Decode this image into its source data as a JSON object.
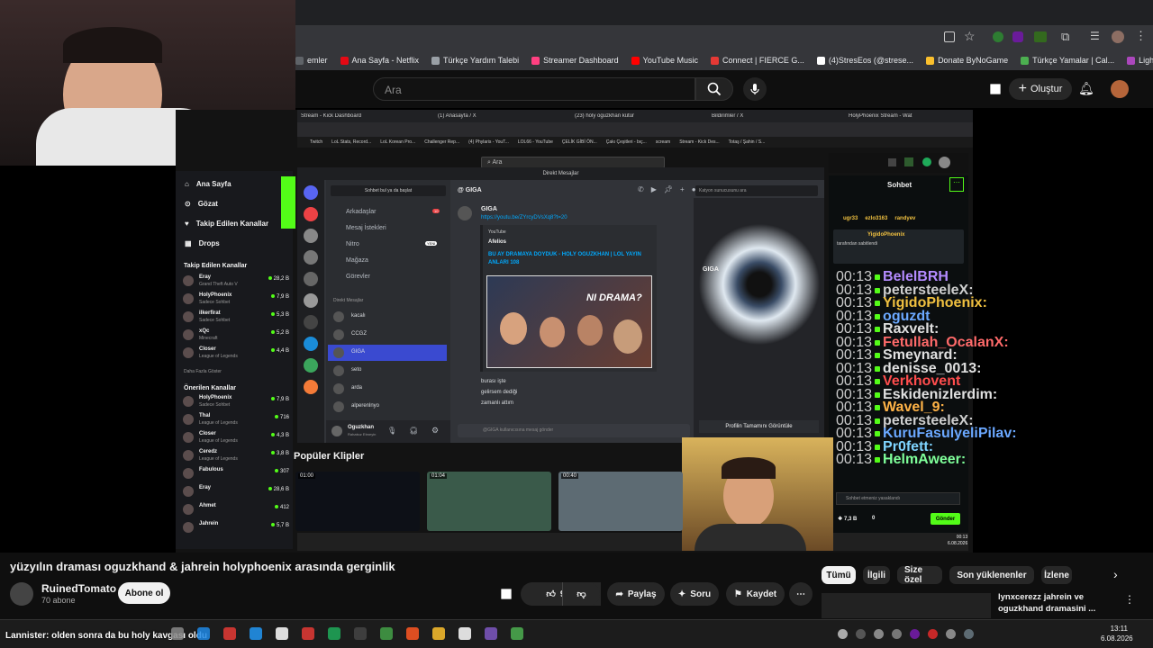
{
  "browser": {
    "bookmarks": [
      {
        "label": "emler",
        "color": "#5f6368"
      },
      {
        "label": "Ana Sayfa - Netflix",
        "color": "#e50914"
      },
      {
        "label": "Türkçe Yardım Talebi",
        "color": "#9aa0a6"
      },
      {
        "label": "Streamer Dashboard",
        "color": "#ff4081"
      },
      {
        "label": "YouTube Music",
        "color": "#ff0000"
      },
      {
        "label": "Connect | FIERCE G...",
        "color": "#e53935"
      },
      {
        "label": "(4)StresEos (@strese...",
        "color": "#ffffff"
      },
      {
        "label": "Donate ByNoGame",
        "color": "#fbc02d"
      },
      {
        "label": "Türkçe Yamalar | Cal...",
        "color": "#4caf50"
      },
      {
        "label": "Lightshot — Mac &...",
        "color": "#ab47bc"
      }
    ]
  },
  "header": {
    "search_placeholder": "Ara",
    "create_label": "Oluştur"
  },
  "stream": {
    "tabs": [
      "Stream - Kick Dashboard",
      "(1) Anasayfa / X",
      "(23) holy oguzkhan kütür",
      "Bildirimler / X",
      "HolyPhoenix Stream - Wat"
    ],
    "bookmarks": [
      "Twitch",
      "LoL Stats, Record...",
      "LoL Korean Pro...",
      "Challenger Rep...",
      "(4) Phylaris - YouT...",
      "LOL66 - YouTube",
      "ÇELİK GİBİ ÖN...",
      "Çakı Çeşitleri - bıç...",
      "scream",
      "Stream - Kick Des...",
      "Totaş / Şahin / S..."
    ],
    "inner_search": "Ara",
    "kick_nav": [
      "Ana Sayfa",
      "Gözat",
      "Takip Edilen Kanallar",
      "Drops"
    ],
    "followed_title": "Takip Edilen Kanallar",
    "followed": [
      {
        "name": "Eray",
        "game": "Grand Theft Auto V",
        "count": "28,2 B"
      },
      {
        "name": "HolyPhoenix",
        "game": "Sadece Sohbet",
        "count": "7,9 B"
      },
      {
        "name": "ilkerfirat",
        "game": "Sadece Sohbet",
        "count": "5,3 B"
      },
      {
        "name": "xQc",
        "game": "Minecraft",
        "count": "5,2 B"
      },
      {
        "name": "Closer",
        "game": "League of Legends",
        "count": "4,4 B"
      }
    ],
    "more_label": "Daha Fazla Göster",
    "suggested_title": "Önerilen Kanallar",
    "suggested": [
      {
        "name": "HolyPhoenix",
        "game": "Sadece Sohbet",
        "count": "7,9 B"
      },
      {
        "name": "Thal",
        "game": "League of Legends",
        "count": "716"
      },
      {
        "name": "Closer",
        "game": "League of Legends",
        "count": "4,3 B"
      },
      {
        "name": "Ceredz",
        "game": "League of Legends",
        "count": "3,8 B"
      },
      {
        "name": "Fabulous",
        "game": "",
        "count": "307"
      },
      {
        "name": "Eray",
        "game": "",
        "count": "28,6 B"
      },
      {
        "name": "Ahmet",
        "game": "",
        "count": "412"
      },
      {
        "name": "Jahrein",
        "game": "",
        "count": "5,7 B"
      }
    ],
    "discord": {
      "window_title": "Direkt Mesajlar",
      "start_chat": "Sohbet bul ya da başlat",
      "nav": [
        "Arkadaşlar",
        "Mesaj İstekleri",
        "Nitro",
        "Mağaza",
        "Görevler"
      ],
      "requests_badge": "10",
      "nitro_badge": "YENİ",
      "dm_header": "Direkt Mesajlar",
      "dms": [
        "kacalı",
        "CCGZ",
        "GIGA",
        "seto",
        "arda",
        "alperenlnyo"
      ],
      "user_name": "Oguzkhan",
      "user_status": "Rahatsız Etmeyin",
      "chat_user": "GIGA",
      "msg_author": "GIGA",
      "link": "https://youtu.be/ZYrcyDVsXq8?t=20",
      "embed_source": "YouTube",
      "embed_channel": "Afelios",
      "embed_title": "BU AY DRAMAYA DOYDUK - HOLY OGUZKHAN | LOL YAYIN ANLARI 108",
      "messages": [
        "burası işte",
        "gelirsem dediği",
        "zamanlı attım"
      ],
      "input_placeholder": "@GIGA kullanıcısına mesaj gönder",
      "profile_name": "GIGA",
      "profile_button": "Profilin Tamamını Görüntüle",
      "search_placeholder": "Katyon sunucusunu ara"
    },
    "chat": {
      "title": "Sohbet",
      "viewers": [
        "ugr33",
        "ezlo3163",
        "randyev"
      ],
      "pinned_user": "YigidoPhoenix",
      "pinned_text": "tarafından sabitlendi",
      "messages": [
        {
          "time": "00:13",
          "user": "BelelBRH",
          "color": "#b48bff"
        },
        {
          "time": "00:13",
          "user": "petersteeleX:",
          "color": "#cfcfcf"
        },
        {
          "time": "00:13",
          "user": "YigidoPhoenix:",
          "color": "#f0c040"
        },
        {
          "time": "00:13",
          "user": "oguzdt",
          "color": "#6ba8ff"
        },
        {
          "time": "00:13",
          "user": "Raxvelt:",
          "color": "#e0e0e0"
        },
        {
          "time": "00:13",
          "user": "Fetullah_OcalanX:",
          "color": "#ff6a6a"
        },
        {
          "time": "00:13",
          "user": "Smeynard:",
          "color": "#e0e0e0"
        },
        {
          "time": "00:13",
          "user": "denisse_0013:",
          "color": "#e0e0e0"
        },
        {
          "time": "00:13",
          "user": "Verkhovent",
          "color": "#ff4d4d"
        },
        {
          "time": "00:13",
          "user": "Eskidenizlerdim:",
          "color": "#e0e0e0"
        },
        {
          "time": "00:13",
          "user": "Wavel_9:",
          "color": "#ffb347"
        },
        {
          "time": "00:13",
          "user": "petersteeleX:",
          "color": "#cfcfcf"
        },
        {
          "time": "00:13",
          "user": "KuruFasulyeliPilav:",
          "color": "#6ba8ff"
        },
        {
          "time": "00:13",
          "user": "Pr0fett:",
          "color": "#7fd4ff"
        },
        {
          "time": "00:13",
          "user": "HelmAweer:",
          "color": "#7fff9a"
        }
      ],
      "input_placeholder": "Sohbet etmeniz yasaklandı",
      "points": "7,3 B",
      "zero": "0",
      "send_label": "Gönder"
    },
    "clips_title": "Popüler Klipler",
    "clips": [
      {
        "duration": "01:00"
      },
      {
        "duration": "01:04"
      },
      {
        "duration": "00:40"
      }
    ],
    "inner_clock": {
      "time": "00:13",
      "date": "6.08.2026"
    }
  },
  "video": {
    "title": "yüzyılın draması oguzkhand & jahrein holyphoenix arasında gerginlik",
    "channel": "RuinedTomato",
    "subscribers": "70 abone",
    "subscribe_label": "Abone ol",
    "likes": "908",
    "share_label": "Paylaş",
    "ask_label": "Soru",
    "save_label": "Kaydet"
  },
  "recommend": {
    "chips": [
      "Tümü",
      "İlgili",
      "Size özel",
      "Son yüklenenler",
      "İzlene"
    ],
    "first_title": "lynxcerezz jahrein ve oguzkhand dramasini ..."
  },
  "taskbar": {
    "caption": "Lannister: olden sonra da bu holy kavgası oldu",
    "time": "13:11",
    "date": "6.08.2026"
  },
  "colors": {
    "kick_green": "#53fc18",
    "yt_bg": "#0f0f0f",
    "discord_blurple": "#5865f2"
  }
}
